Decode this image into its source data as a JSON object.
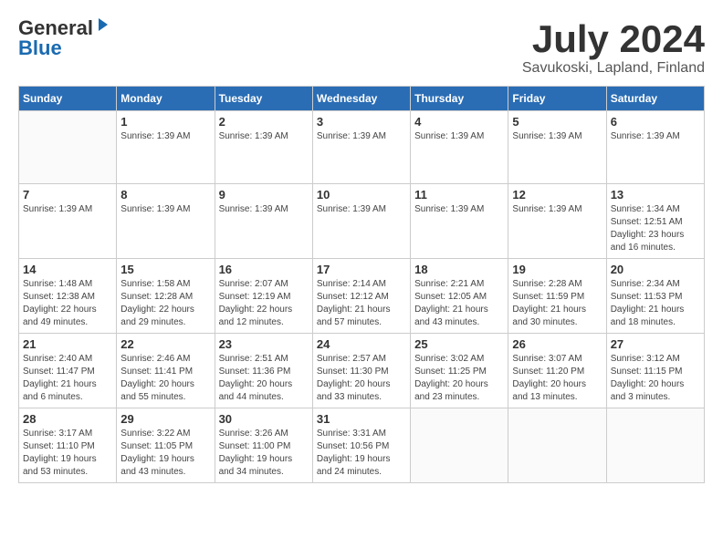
{
  "header": {
    "logo_general": "General",
    "logo_blue": "Blue",
    "month_title": "July 2024",
    "location": "Savukoski, Lapland, Finland"
  },
  "weekdays": [
    "Sunday",
    "Monday",
    "Tuesday",
    "Wednesday",
    "Thursday",
    "Friday",
    "Saturday"
  ],
  "weeks": [
    [
      {
        "day": "",
        "info": ""
      },
      {
        "day": "1",
        "info": "Sunrise: 1:39 AM"
      },
      {
        "day": "2",
        "info": "Sunrise: 1:39 AM"
      },
      {
        "day": "3",
        "info": "Sunrise: 1:39 AM"
      },
      {
        "day": "4",
        "info": "Sunrise: 1:39 AM"
      },
      {
        "day": "5",
        "info": "Sunrise: 1:39 AM"
      },
      {
        "day": "6",
        "info": "Sunrise: 1:39 AM"
      }
    ],
    [
      {
        "day": "7",
        "info": "Sunrise: 1:39 AM"
      },
      {
        "day": "8",
        "info": "Sunrise: 1:39 AM"
      },
      {
        "day": "9",
        "info": "Sunrise: 1:39 AM"
      },
      {
        "day": "10",
        "info": "Sunrise: 1:39 AM"
      },
      {
        "day": "11",
        "info": "Sunrise: 1:39 AM"
      },
      {
        "day": "12",
        "info": "Sunrise: 1:39 AM"
      },
      {
        "day": "13",
        "info": "Sunrise: 1:34 AM\nSunset: 12:51 AM\nDaylight: 23 hours and 16 minutes."
      }
    ],
    [
      {
        "day": "14",
        "info": "Sunrise: 1:48 AM\nSunset: 12:38 AM\nDaylight: 22 hours and 49 minutes."
      },
      {
        "day": "15",
        "info": "Sunrise: 1:58 AM\nSunset: 12:28 AM\nDaylight: 22 hours and 29 minutes."
      },
      {
        "day": "16",
        "info": "Sunrise: 2:07 AM\nSunset: 12:19 AM\nDaylight: 22 hours and 12 minutes."
      },
      {
        "day": "17",
        "info": "Sunrise: 2:14 AM\nSunset: 12:12 AM\nDaylight: 21 hours and 57 minutes."
      },
      {
        "day": "18",
        "info": "Sunrise: 2:21 AM\nSunset: 12:05 AM\nDaylight: 21 hours and 43 minutes."
      },
      {
        "day": "19",
        "info": "Sunrise: 2:28 AM\nSunset: 11:59 PM\nDaylight: 21 hours and 30 minutes."
      },
      {
        "day": "20",
        "info": "Sunrise: 2:34 AM\nSunset: 11:53 PM\nDaylight: 21 hours and 18 minutes."
      }
    ],
    [
      {
        "day": "21",
        "info": "Sunrise: 2:40 AM\nSunset: 11:47 PM\nDaylight: 21 hours and 6 minutes."
      },
      {
        "day": "22",
        "info": "Sunrise: 2:46 AM\nSunset: 11:41 PM\nDaylight: 20 hours and 55 minutes."
      },
      {
        "day": "23",
        "info": "Sunrise: 2:51 AM\nSunset: 11:36 PM\nDaylight: 20 hours and 44 minutes."
      },
      {
        "day": "24",
        "info": "Sunrise: 2:57 AM\nSunset: 11:30 PM\nDaylight: 20 hours and 33 minutes."
      },
      {
        "day": "25",
        "info": "Sunrise: 3:02 AM\nSunset: 11:25 PM\nDaylight: 20 hours and 23 minutes."
      },
      {
        "day": "26",
        "info": "Sunrise: 3:07 AM\nSunset: 11:20 PM\nDaylight: 20 hours and 13 minutes."
      },
      {
        "day": "27",
        "info": "Sunrise: 3:12 AM\nSunset: 11:15 PM\nDaylight: 20 hours and 3 minutes."
      }
    ],
    [
      {
        "day": "28",
        "info": "Sunrise: 3:17 AM\nSunset: 11:10 PM\nDaylight: 19 hours and 53 minutes."
      },
      {
        "day": "29",
        "info": "Sunrise: 3:22 AM\nSunset: 11:05 PM\nDaylight: 19 hours and 43 minutes."
      },
      {
        "day": "30",
        "info": "Sunrise: 3:26 AM\nSunset: 11:00 PM\nDaylight: 19 hours and 34 minutes."
      },
      {
        "day": "31",
        "info": "Sunrise: 3:31 AM\nSunset: 10:56 PM\nDaylight: 19 hours and 24 minutes."
      },
      {
        "day": "",
        "info": ""
      },
      {
        "day": "",
        "info": ""
      },
      {
        "day": "",
        "info": ""
      }
    ]
  ]
}
